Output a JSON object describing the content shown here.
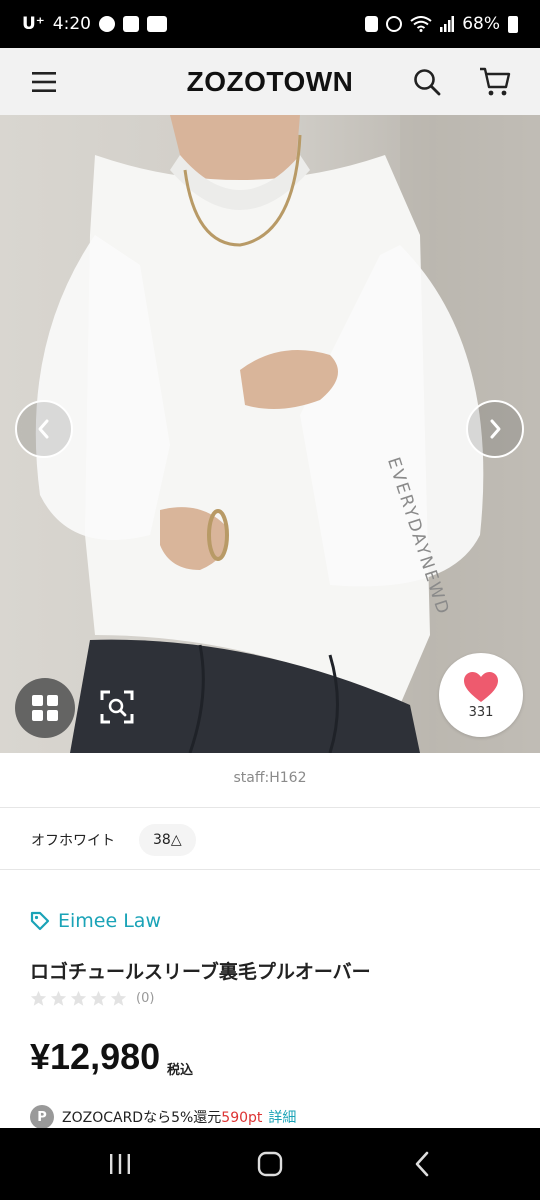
{
  "status_bar": {
    "carrier": "U⁺",
    "time": "4:20",
    "battery": "68%"
  },
  "header": {
    "logo": "ZOZOTOWN"
  },
  "hero": {
    "sleeve_print": "EVERYDAYNEWD",
    "caption": "staff:H162",
    "like_count": "331"
  },
  "variant": {
    "color": "オフホワイト",
    "size": "38△"
  },
  "product": {
    "brand": "Eimee Law",
    "title": "ロゴチュールスリーブ裏毛プルオーバー",
    "review_count": "(0)",
    "price": "¥12,980",
    "tax_label": "税込",
    "points": {
      "badge": "P",
      "text": "ZOZOCARDなら5%還元",
      "pt": "590pt",
      "detail_label": "詳細"
    }
  },
  "colors": {
    "accent": "#1aa3b7",
    "heart": "#ee5a6e",
    "points": "#d33333"
  }
}
